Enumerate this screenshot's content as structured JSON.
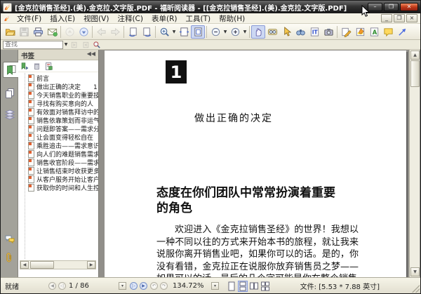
{
  "window": {
    "title": "[金克拉销售圣经].(美).金克拉.文字版.PDF - 福昕阅读器 - [[金克拉销售圣经].(美).金克拉.文字版.PDF]",
    "controls": {
      "minimize": "–",
      "maximize": "❐",
      "close": "✕"
    },
    "doc_controls": {
      "minimize": "_",
      "restore": "❐",
      "close": "×"
    }
  },
  "menu": {
    "items": [
      "文件(F)",
      "插入(E)",
      "视图(V)",
      "注释(C)",
      "表单(R)",
      "工具(T)",
      "帮助(H)"
    ]
  },
  "toolbar": {
    "icons": [
      "open-icon",
      "save-icon",
      "print-icon",
      "email-icon",
      "first-page-icon",
      "last-page-icon",
      "back-icon",
      "forward-icon",
      "prev-view-icon",
      "next-view-icon",
      "zoom-tool-icon",
      "fit-width-icon",
      "fit-page-icon",
      "zoom-out-icon",
      "zoom-in-icon",
      "hand-tool-icon",
      "loupe-icon",
      "select-tool-icon",
      "find-icon",
      "select-text-icon",
      "snapshot-icon",
      "pencil-icon",
      "highlight-icon",
      "typewriter-icon",
      "note-icon",
      "arrow-tool-icon"
    ],
    "active_tool": "hand-tool"
  },
  "find": {
    "placeholder": "查找"
  },
  "sidebar": {
    "tabs": [
      "bookmarks",
      "pages",
      "layers",
      "comments",
      "attachments"
    ],
    "active_tab": "bookmarks"
  },
  "bookmarks_panel": {
    "title": "书签",
    "items": [
      "前言",
      "做出正确的决定　　1",
      "今天销售职业的重要技巧",
      "寻找有购买意向的人",
      "有效面对销售拜访中的恐惧",
      "销售依靠策划而非运气",
      "问题即答案——需求分析",
      "让会面变得轻松自在",
      "乘胜追击——需求意识",
      "向人们的难题销售需求解决",
      "销售收官阶段——需求满足",
      "让销售结束时收获更多",
      "从客户服务开始让客户满意",
      "获取你的时间和人生控制权"
    ]
  },
  "document": {
    "chapter_number": "1",
    "chapter_title": "做出正确的决定",
    "section_heading": "态度在你们团队中常常扮演着重要的角色",
    "paragraph": "欢迎进入《金克拉销售圣经》的世界！我想以一种不同以往的方式来开始本书的旅程，就让我来说服你离开销售业吧，如果你可以的话。是的，你没有看错，金克拉正在说服你放弃销售员之梦——如果可以的话，最后的几个字可能是你在整个销售"
  },
  "status_bar": {
    "ready": "就绪",
    "page_display": "1 / 86",
    "zoom": "134.72%",
    "file_info": "文件: [5.53 * 7.88 英寸]"
  }
}
